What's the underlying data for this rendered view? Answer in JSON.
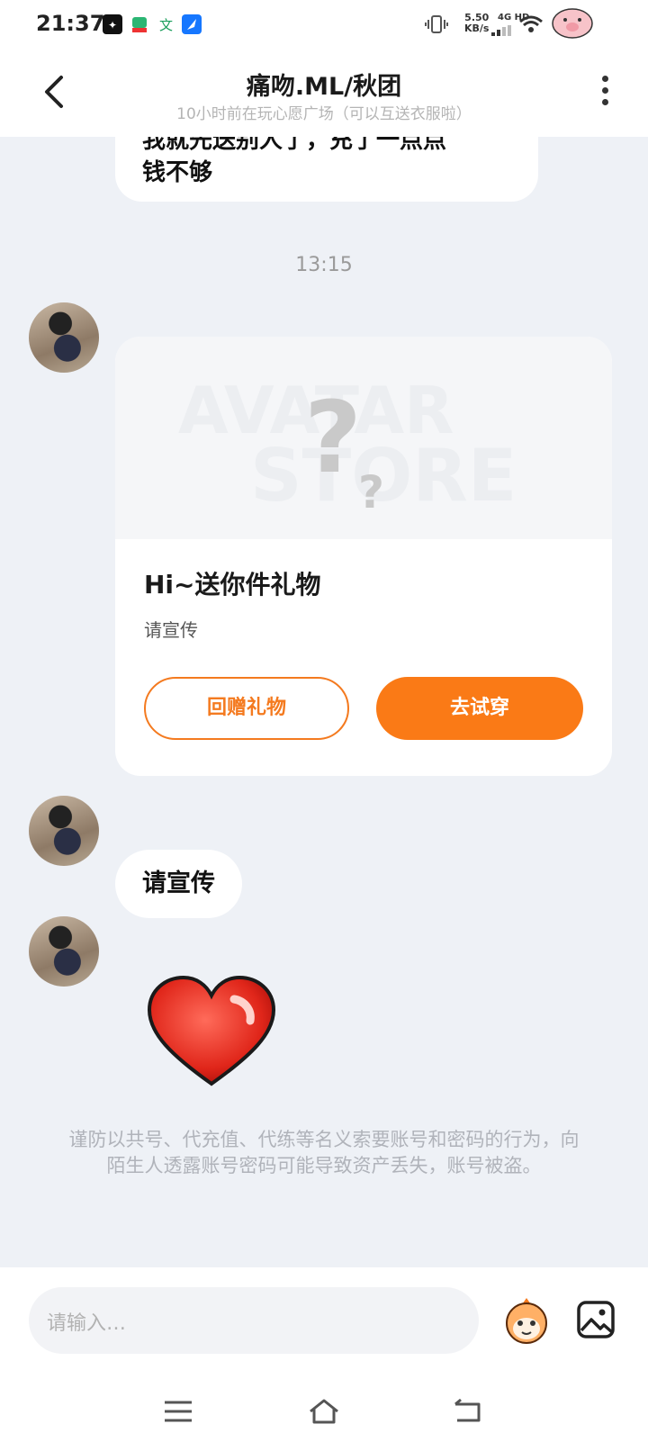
{
  "status_bar": {
    "time": "21:37",
    "speed_value": "5.50",
    "speed_unit": "KB/s",
    "network": "4G HD",
    "icons": [
      "notification-icon",
      "video-app-icon",
      "translate-app-icon",
      "feather-app-icon",
      "vibrate-icon",
      "signal-icon",
      "wifi-icon",
      "pig-avatar-icon"
    ]
  },
  "header": {
    "title": "痛吻.ML/秋团",
    "subtitle": "10小时前在玩心愿广场（可以互送衣服啦）",
    "back_icon": "chevron-left-icon",
    "more_icon": "more-vertical-icon"
  },
  "messages": {
    "previous_text_line1": "我就先送别人了，充了一点点",
    "previous_text_line2": "钱不够",
    "timestamp": "13:15",
    "gift_card": {
      "watermark_line1": "AVATAR",
      "watermark_line2": "STORE",
      "title": "Hi~送你件礼物",
      "description": "请宣传",
      "return_gift_label": "回赠礼物",
      "try_on_label": "去试穿"
    },
    "text_message": "请宣传",
    "sticker": "heart-sticker-icon"
  },
  "notice": "谨防以共号、代充值、代练等名义索要账号和密码的行为，向陌生人透露账号密码可能导致资产丢失，账号被盗。",
  "input": {
    "placeholder": "请输入…",
    "emoji_icon": "mascot-emoji-icon",
    "image_icon": "image-picker-icon"
  },
  "nav": [
    "menu-icon",
    "home-icon",
    "back-icon"
  ],
  "colors": {
    "accent": "#fa7a16",
    "background": "#eef1f6",
    "bubble": "#ffffff"
  }
}
